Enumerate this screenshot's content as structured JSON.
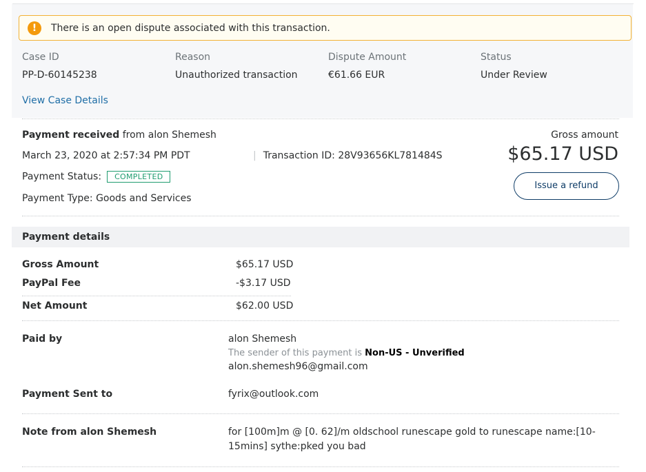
{
  "alert": {
    "icon": "exclamation-icon",
    "glyph": "!",
    "message": "There is an open dispute associated with this transaction."
  },
  "case": {
    "columns": [
      {
        "label": "Case ID",
        "value": "PP-D-60145238"
      },
      {
        "label": "Reason",
        "value": "Unauthorized transaction"
      },
      {
        "label": "Dispute Amount",
        "value": "€61.66 EUR"
      },
      {
        "label": "Status",
        "value": "Under Review"
      }
    ],
    "view_details_link": "View Case Details"
  },
  "summary": {
    "received_label": "Payment received",
    "from_text": "from alon Shemesh",
    "datetime": "March 23, 2020 at 2:57:34 PM PDT",
    "separator": "|",
    "transaction_id": "Transaction ID: 28V93656KL781484S",
    "status_label": "Payment Status:",
    "status_badge": "COMPLETED",
    "type": "Payment Type: Goods and Services",
    "gross_label": "Gross amount",
    "gross_value": "$65.17 USD",
    "refund_button": "Issue a refund"
  },
  "details": {
    "header": "Payment details",
    "gross_label": "Gross Amount",
    "gross_value": "$65.17 USD",
    "fee_label": "PayPal Fee",
    "fee_value": "-$3.17 USD",
    "net_label": "Net Amount",
    "net_value": "$62.00 USD"
  },
  "paid_by": {
    "label": "Paid by",
    "name": "alon Shemesh",
    "sender_prefix": "The sender of this payment is",
    "sender_status": "Non-US - Unverified",
    "email": "alon.shemesh96@gmail.com"
  },
  "sent_to": {
    "label": "Payment Sent to",
    "email": "fyrix@outlook.com"
  },
  "note": {
    "label": "Note from alon Shemesh",
    "text": "for [100m]m @ [0. 62]/m oldschool runescape gold to runescape name:[10-15mins] sythe:pked you bad"
  },
  "colors": {
    "link": "#1f6ea6",
    "alert_border": "#f2b134",
    "alert_icon": "#f49a0c",
    "badge": "#1f9c6f",
    "button_border": "#0d3b66"
  }
}
